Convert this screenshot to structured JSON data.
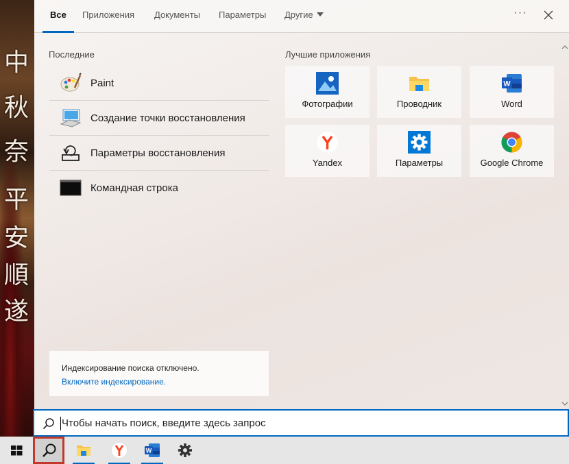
{
  "wallpaper": {
    "glyphs": [
      "中",
      "秋",
      "奈",
      "平",
      "安",
      "順",
      "遂"
    ]
  },
  "tabs": [
    {
      "label": "Все",
      "active": true
    },
    {
      "label": "Приложения",
      "active": false
    },
    {
      "label": "Документы",
      "active": false
    },
    {
      "label": "Параметры",
      "active": false
    },
    {
      "label": "Другие",
      "active": false,
      "dropdown": true
    }
  ],
  "header": {
    "more_label": "···",
    "close_icon": "close-icon"
  },
  "recent": {
    "title": "Последние",
    "items": [
      {
        "label": "Paint",
        "icon": "paint-palette-icon"
      },
      {
        "label": "Создание точки восстановления",
        "icon": "system-protection-icon"
      },
      {
        "label": "Параметры восстановления",
        "icon": "recovery-icon"
      },
      {
        "label": "Командная строка",
        "icon": "command-prompt-icon"
      }
    ]
  },
  "best_apps": {
    "title": "Лучшие приложения",
    "tiles": [
      {
        "label": "Фотографии",
        "icon": "photos-icon"
      },
      {
        "label": "Проводник",
        "icon": "file-explorer-icon"
      },
      {
        "label": "Word",
        "icon": "word-icon"
      },
      {
        "label": "Yandex",
        "icon": "yandex-browser-icon"
      },
      {
        "label": "Параметры",
        "icon": "settings-gear-icon"
      },
      {
        "label": "Google Chrome",
        "icon": "chrome-icon"
      }
    ]
  },
  "indexing": {
    "message": "Индексирование поиска отключено.",
    "link": "Включите индексирование."
  },
  "search": {
    "placeholder": "Чтобы начать поиск, введите здесь запрос",
    "value": ""
  },
  "taskbar": {
    "items": [
      "windows-start-icon",
      "search-icon",
      "file-explorer-icon",
      "yandex-browser-icon",
      "word-icon",
      "settings-gear-icon"
    ]
  },
  "colors": {
    "accent": "#0067c0",
    "highlight_border": "#c0392b"
  }
}
